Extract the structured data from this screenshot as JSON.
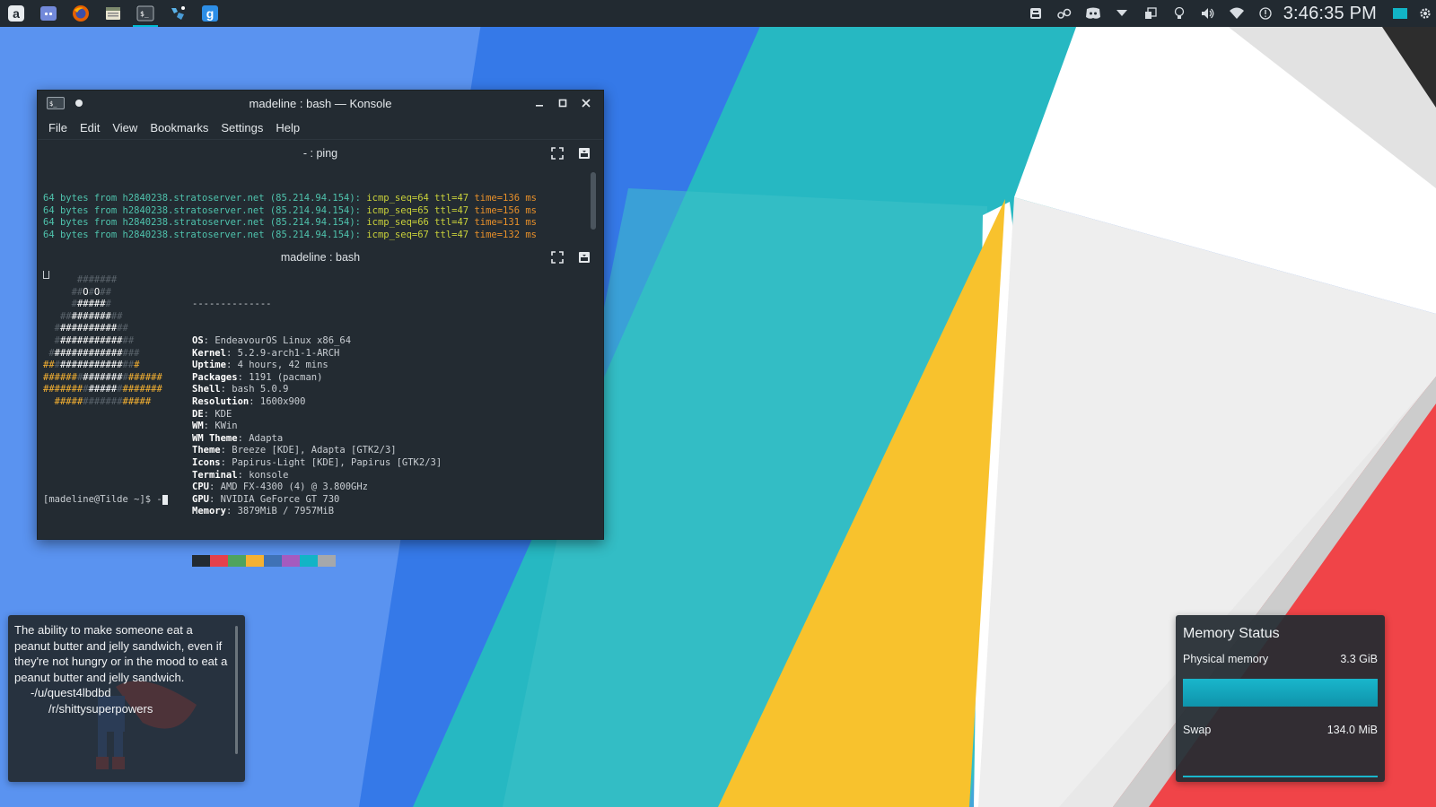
{
  "taskbar": {
    "launchers": [
      {
        "name": "app-launcher-icon",
        "glyph": "a"
      },
      {
        "name": "discord-icon",
        "glyph": ""
      },
      {
        "name": "firefox-icon",
        "glyph": ""
      },
      {
        "name": "file-manager-icon",
        "glyph": ""
      },
      {
        "name": "konsole-icon",
        "glyph": "$_",
        "active": true
      },
      {
        "name": "itch-icon",
        "glyph": ""
      },
      {
        "name": "g-app-icon",
        "glyph": "g"
      }
    ],
    "clock": "3:46:35 PM"
  },
  "konsole": {
    "title": "madeline : bash — Konsole",
    "menu": [
      "File",
      "Edit",
      "View",
      "Bookmarks",
      "Settings",
      "Help"
    ],
    "ping_pane": {
      "title": "- : ping",
      "lines": [
        {
          "a": "64 bytes from h2840238.stratoserver.net (85.214.94.154): ",
          "b": "icmp_seq=64 ttl=47 ",
          "c": "time=136 ms"
        },
        {
          "a": "64 bytes from h2840238.stratoserver.net (85.214.94.154): ",
          "b": "icmp_seq=65 ttl=47 ",
          "c": "time=156 ms"
        },
        {
          "a": "64 bytes from h2840238.stratoserver.net (85.214.94.154): ",
          "b": "icmp_seq=66 ttl=47 ",
          "c": "time=131 ms"
        },
        {
          "a": "64 bytes from h2840238.stratoserver.net (85.214.94.154): ",
          "b": "icmp_seq=67 ttl=47 ",
          "c": "time=132 ms"
        }
      ]
    },
    "bash_pane": {
      "title": "madeline : bash",
      "separator": "--------------",
      "info": [
        {
          "k": "OS",
          "v": "EndeavourOS Linux x86_64"
        },
        {
          "k": "Kernel",
          "v": "5.2.9-arch1-1-ARCH"
        },
        {
          "k": "Uptime",
          "v": "4 hours, 42 mins"
        },
        {
          "k": "Packages",
          "v": "1191 (pacman)"
        },
        {
          "k": "Shell",
          "v": "bash 5.0.9"
        },
        {
          "k": "Resolution",
          "v": "1600x900"
        },
        {
          "k": "DE",
          "v": "KDE"
        },
        {
          "k": "WM",
          "v": "KWin"
        },
        {
          "k": "WM Theme",
          "v": "Adapta"
        },
        {
          "k": "Theme",
          "v": "Breeze [KDE], Adapta [GTK2/3]"
        },
        {
          "k": "Icons",
          "v": "Papirus-Light [KDE], Papirus [GTK2/3]"
        },
        {
          "k": "Terminal",
          "v": "konsole"
        },
        {
          "k": "CPU",
          "v": "AMD FX-4300 (4) @ 3.800GHz"
        },
        {
          "k": "GPU",
          "v": "NVIDIA GeForce GT 730"
        },
        {
          "k": "Memory",
          "v": "3879MiB / 7957MiB"
        }
      ],
      "palette": [
        "#232b32",
        "#e5414b",
        "#4fa35d",
        "#f5b132",
        "#3f72b6",
        "#a55bbf",
        "#12b4c6",
        "#a5a8ab"
      ],
      "prompt": "[madeline@Tilde ~]$ -"
    }
  },
  "quote_widget": {
    "text": "The ability to make someone eat a peanut butter and jelly sandwich, even if they're not hungry or in the mood to eat a peanut butter and jelly sandwich.",
    "author": "-/u/quest4lbdbd",
    "subreddit": "/r/shittysuperpowers"
  },
  "memory_widget": {
    "title": "Memory Status",
    "physical_label": "Physical memory",
    "physical_value": "3.3 GiB",
    "physical_fraction": 0.998,
    "swap_label": "Swap",
    "swap_value": "134.0 MiB",
    "swap_fraction": 1.0
  },
  "colors": {
    "accent": "#19b6cc",
    "panel_bg": "#222a31",
    "window_bg": "#232b32"
  }
}
